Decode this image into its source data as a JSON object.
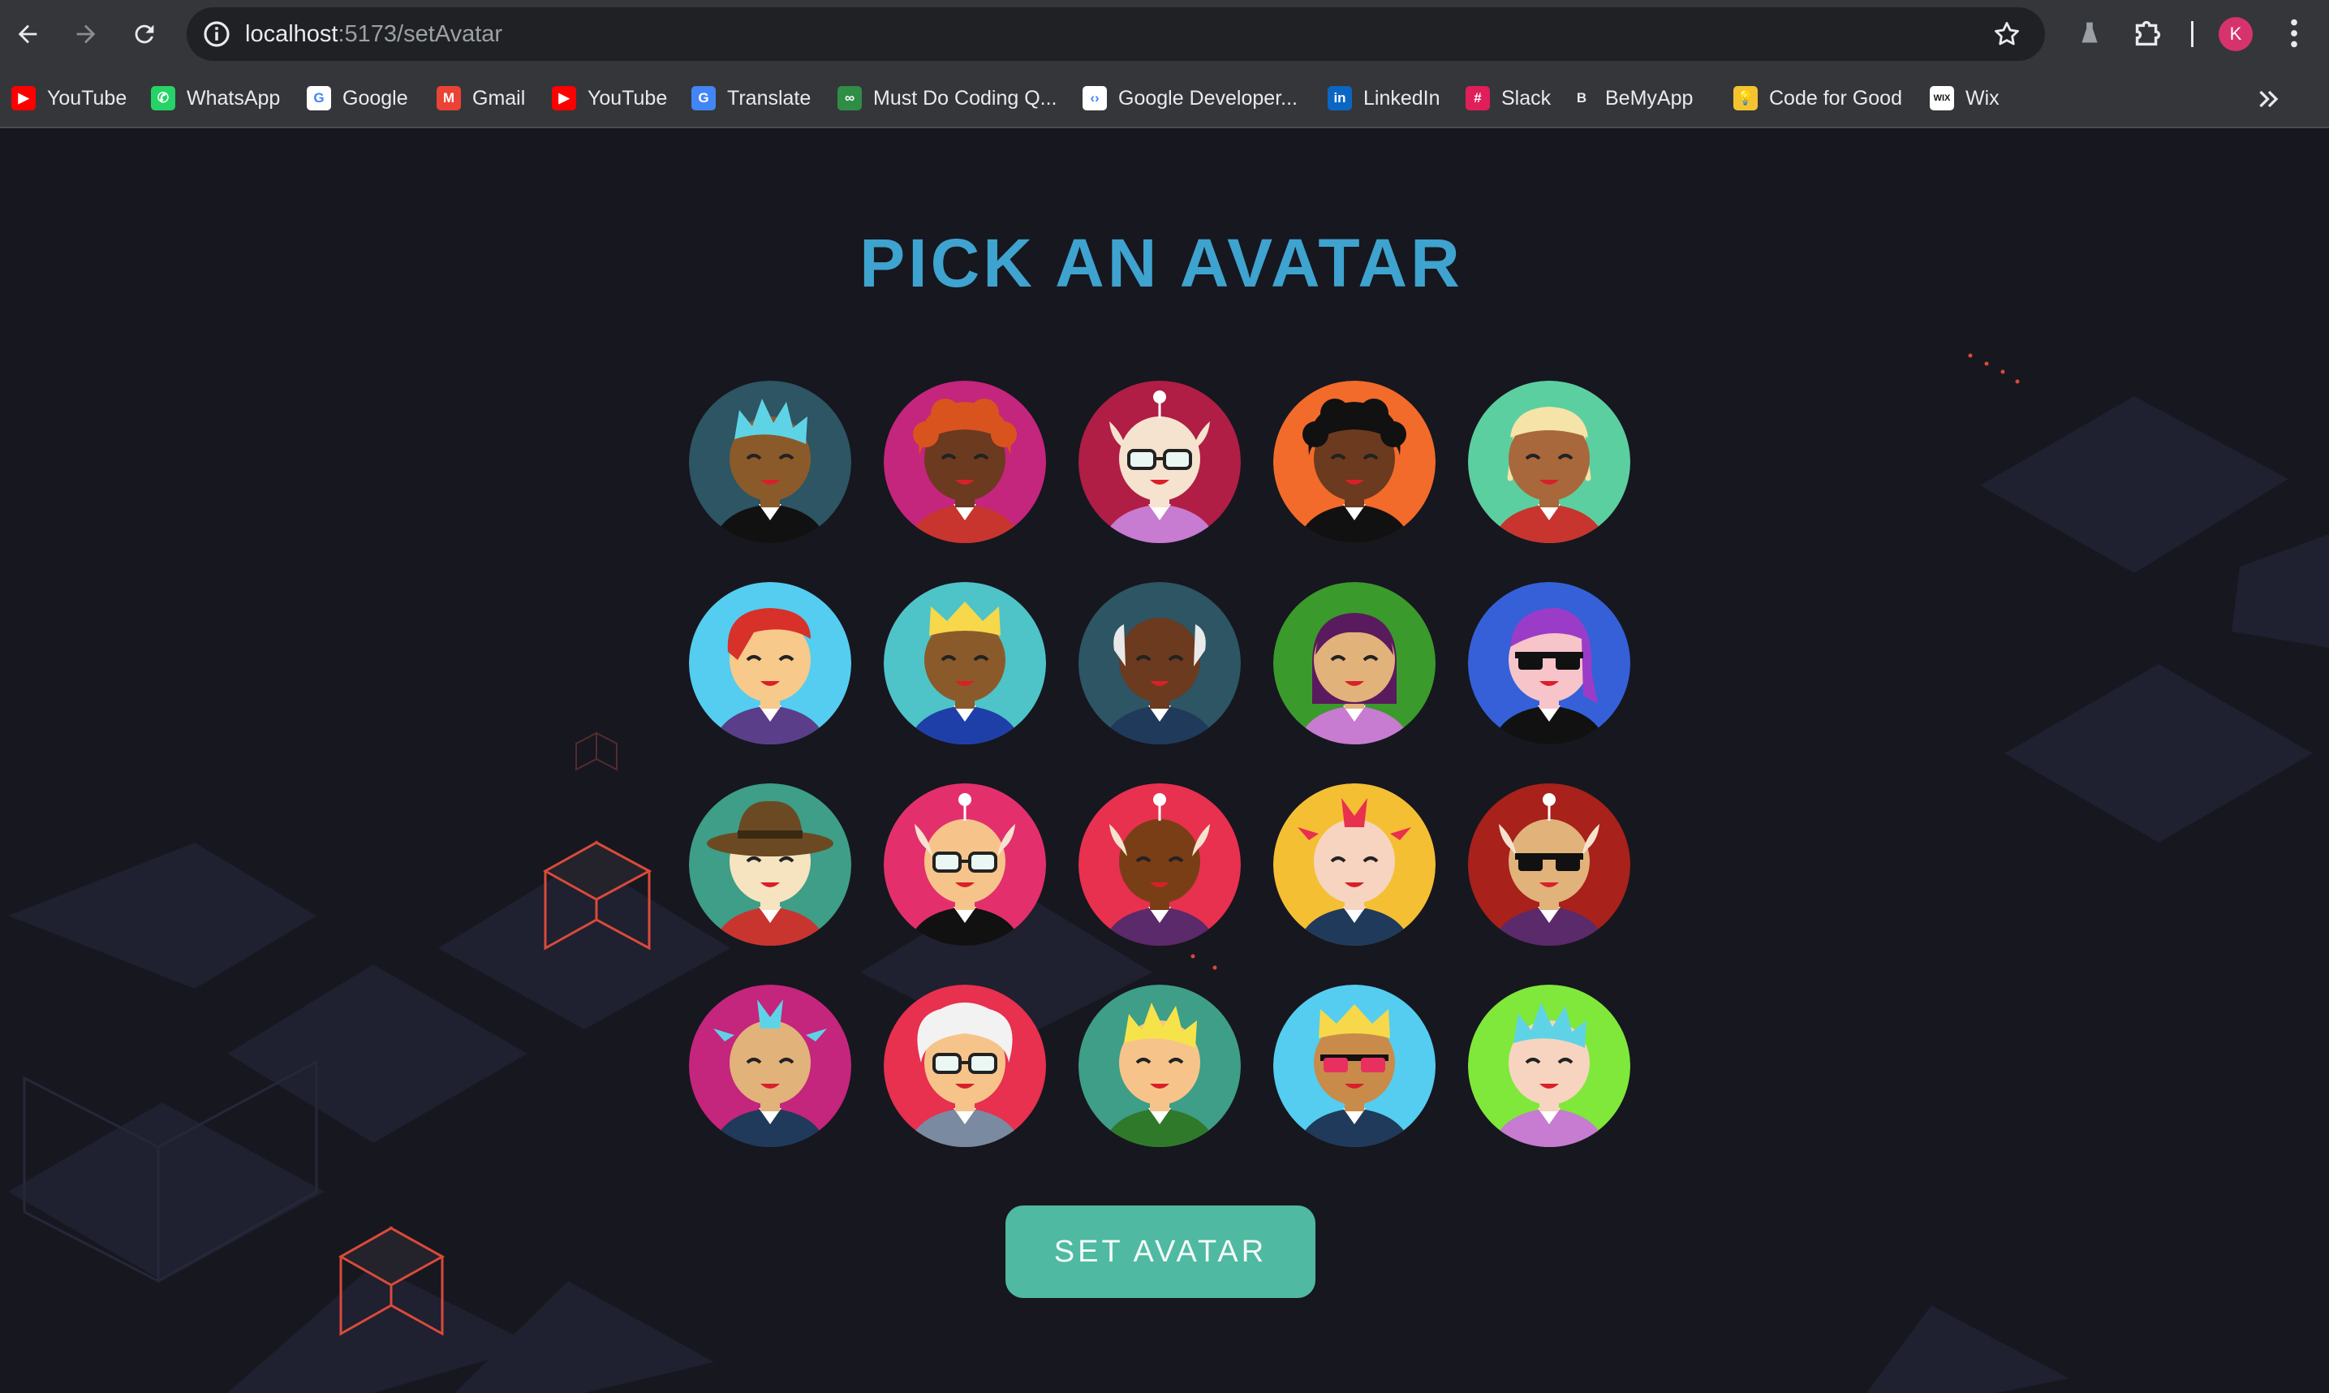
{
  "browser": {
    "url_host": "localhost",
    "url_path": ":5173/setAvatar",
    "profile_initial": "K"
  },
  "bookmarks": [
    {
      "label": "YouTube",
      "icon": "youtube-icon",
      "color": "#ff0000"
    },
    {
      "label": "WhatsApp",
      "icon": "whatsapp-icon",
      "color": "#25d366"
    },
    {
      "label": "Google",
      "icon": "google-icon",
      "color": "#ffffff"
    },
    {
      "label": "Gmail",
      "icon": "gmail-icon",
      "color": "#ea4335"
    },
    {
      "label": "YouTube",
      "icon": "youtube-icon",
      "color": "#ff0000"
    },
    {
      "label": "Translate",
      "icon": "translate-icon",
      "color": "#4285f4"
    },
    {
      "label": "Must Do Coding Q...",
      "icon": "geeksforgeeks-icon",
      "color": "#2f8d46"
    },
    {
      "label": "Google Developer...",
      "icon": "google-developers-icon",
      "color": "#ffffff"
    },
    {
      "label": "LinkedIn",
      "icon": "linkedin-icon",
      "color": "#0a66c2"
    },
    {
      "label": "Slack",
      "icon": "slack-icon",
      "color": "#e01e5a"
    },
    {
      "label": "BeMyApp",
      "icon": "bemyapp-icon",
      "color": "#35363a"
    },
    {
      "label": "Code for Good",
      "icon": "lightbulb-icon",
      "color": "#f4c430"
    },
    {
      "label": "Wix",
      "icon": "wix-icon",
      "color": "#ffffff"
    }
  ],
  "page": {
    "title": "PICK AN AVATAR",
    "button_label": "SET AVATAR",
    "accent_color": "#3ea3cf",
    "button_color": "#4fb9a2"
  },
  "avatars": [
    {
      "bg": "#2d5563",
      "skin": "#8b5a2b",
      "hair": "#5fd3e6",
      "shirt": "#111111",
      "style": "spiky"
    },
    {
      "bg": "#c4257d",
      "skin": "#6b3a1f",
      "hair": "#d9531e",
      "shirt": "#c8352e",
      "style": "afro"
    },
    {
      "bg": "#b01e45",
      "skin": "#f6e3cf",
      "hair": "#f6e3cf",
      "shirt": "#c77bd1",
      "style": "antenna-glasses"
    },
    {
      "bg": "#f26b2a",
      "skin": "#6b3a1f",
      "hair": "#111111",
      "shirt": "#111111",
      "style": "afro"
    },
    {
      "bg": "#5ccfa0",
      "skin": "#a8683b",
      "hair": "#f6e3a8",
      "shirt": "#c8352e",
      "style": "dreads"
    },
    {
      "bg": "#54cdf0",
      "skin": "#f7c98a",
      "hair": "#d8312a",
      "shirt": "#5a3e8a",
      "style": "side"
    },
    {
      "bg": "#4ec3c8",
      "skin": "#8b5a2b",
      "hair": "#f6d84a",
      "shirt": "#1f3fa8",
      "style": "crown"
    },
    {
      "bg": "#2d5563",
      "skin": "#6b3a1f",
      "hair": "#e9e9e9",
      "shirt": "#1f3a5a",
      "style": "bald"
    },
    {
      "bg": "#3a9a2c",
      "skin": "#e1b27a",
      "hair": "#5a1a5e",
      "shirt": "#c77bd1",
      "style": "long"
    },
    {
      "bg": "#3560d8",
      "skin": "#f6c4c9",
      "hair": "#9b3cc8",
      "shirt": "#111111",
      "style": "shades"
    },
    {
      "bg": "#3e9e88",
      "skin": "#f6e3c0",
      "hair": "#6b4a23",
      "shirt": "#c8352e",
      "style": "hat"
    },
    {
      "bg": "#e3306d",
      "skin": "#f6c48a",
      "hair": "#f6e3cf",
      "shirt": "#111111",
      "style": "antenna-glasses"
    },
    {
      "bg": "#e8304f",
      "skin": "#7a3e16",
      "hair": "#f6e3cf",
      "shirt": "#5a2a6a",
      "style": "antenna"
    },
    {
      "bg": "#f5bf34",
      "skin": "#f6d4c0",
      "hair": "#e8304f",
      "shirt": "#1f3a5a",
      "style": "mohawk"
    },
    {
      "bg": "#a8211b",
      "skin": "#e1b27a",
      "hair": "#f6e3cf",
      "shirt": "#5a2a6a",
      "style": "antenna-shades"
    },
    {
      "bg": "#c4257d",
      "skin": "#e1b27a",
      "hair": "#5fd3e6",
      "shirt": "#1f3a5a",
      "style": "mohawk"
    },
    {
      "bg": "#e8304f",
      "skin": "#f6c48a",
      "hair": "#f2f2f2",
      "shirt": "#7a8aa0",
      "style": "messy-glasses"
    },
    {
      "bg": "#3e9e88",
      "skin": "#f6c48a",
      "hair": "#f6e34a",
      "shirt": "#2f7a2a",
      "style": "spiky"
    },
    {
      "bg": "#54cdf0",
      "skin": "#c98b4a",
      "hair": "#f6d84a",
      "shirt": "#1f3a5a",
      "style": "crown-shades"
    },
    {
      "bg": "#7fe83a",
      "skin": "#f6d4c0",
      "hair": "#5fd3e6",
      "shirt": "#c77bd1",
      "style": "spiky"
    }
  ]
}
